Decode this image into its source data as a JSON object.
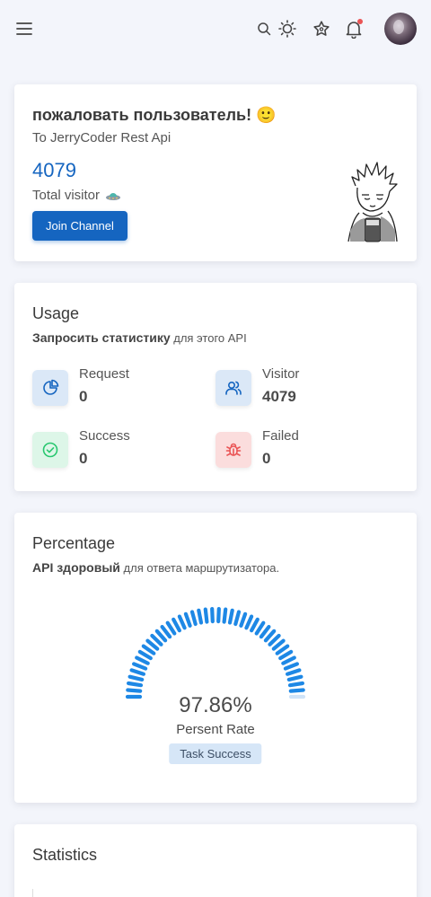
{
  "header": {
    "menu_icon": "hamburger-icon",
    "search_icon": "search-icon",
    "theme_icon": "sun-icon",
    "favorites_icon": "star-icon",
    "notifications_icon": "bell-icon",
    "has_unread_notification": true,
    "avatar": "user-avatar"
  },
  "welcome": {
    "title": "пожаловать пользователь! 🙂",
    "subtitle": "To JerryCoder Rest Api",
    "visitor_count": "4079",
    "visitor_label": "Total visitor",
    "visitor_icon": "ufo-icon",
    "join_button": "Join Channel"
  },
  "usage": {
    "title": "Usage",
    "subtitle_bold": "Запросить статистику",
    "subtitle_rest": " для этого API",
    "stats": [
      {
        "label": "Request",
        "value": "0",
        "icon": "pie-chart-icon",
        "color": "#1565c0",
        "bg": "#dbe8f7"
      },
      {
        "label": "Visitor",
        "value": "4079",
        "icon": "users-icon",
        "color": "#1565c0",
        "bg": "#dbe8f7"
      },
      {
        "label": "Success",
        "value": "0",
        "icon": "check-circle-icon",
        "color": "#28c76f",
        "bg": "#ddf6e8"
      },
      {
        "label": "Failed",
        "value": "0",
        "icon": "bug-icon",
        "color": "#ea5455",
        "bg": "#fbdddd"
      }
    ]
  },
  "percentage": {
    "title": "Percentage",
    "subtitle_bold": "API здоровый",
    "subtitle_rest": " для ответа маршрутизатора.",
    "chart_data": {
      "type": "gauge",
      "value": 97.86,
      "max": 100,
      "display": "97.86%",
      "label": "Persent Rate",
      "chip": "Task Success",
      "color": "#1e88e5"
    }
  },
  "statistics": {
    "title": "Statistics"
  }
}
